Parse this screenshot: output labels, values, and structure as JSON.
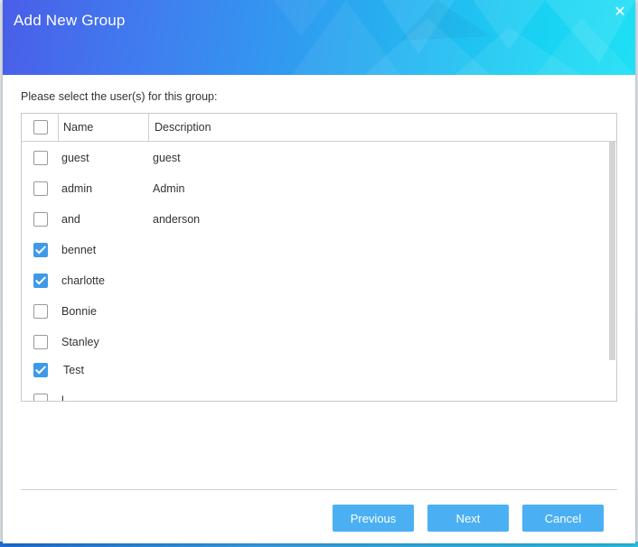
{
  "dialog": {
    "title": "Add New Group",
    "close_symbol": "✕",
    "instruction": "Please select the user(s) for this group:"
  },
  "grid": {
    "columns": {
      "select_all_checked": false,
      "name": "Name",
      "description": "Description"
    },
    "rows": [
      {
        "name": "guest",
        "description": "guest",
        "checked": false
      },
      {
        "name": "admin",
        "description": "Admin",
        "checked": false
      },
      {
        "name": "and",
        "description": "anderson",
        "checked": false
      },
      {
        "name": "bennet",
        "description": "",
        "checked": true
      },
      {
        "name": "charlotte",
        "description": "",
        "checked": true
      },
      {
        "name": "Bonnie",
        "description": "",
        "checked": false
      },
      {
        "name": "Stanley",
        "description": "",
        "checked": false
      },
      {
        "name": "Test",
        "description": "",
        "checked": true
      },
      {
        "name": "l",
        "description": "",
        "checked": false
      }
    ]
  },
  "buttons": {
    "previous": "Previous",
    "next": "Next",
    "cancel": "Cancel"
  },
  "colors": {
    "accent": "#4ab0f3",
    "checkbox_checked": "#3e9ae8",
    "header_gradient_start": "#4a5ee8",
    "header_gradient_end": "#1fe0f5"
  },
  "icons": {
    "close": "close-icon",
    "checkmark": "checkmark-icon"
  }
}
